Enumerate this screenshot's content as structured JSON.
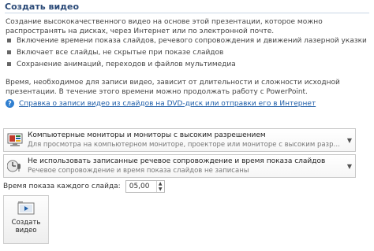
{
  "section": {
    "title": "Создать видео",
    "intro": "Создание высококачественного видео на основе этой презентации, которое можно распространять на дисках, через Интернет или по электронной почте.",
    "bullets": [
      "Включение времени показа слайдов, речевого сопровождения и движений лазерной указки",
      "Включает все слайды, не скрытые при показе слайдов",
      "Сохранение анимаций, переходов и файлов мультимедиа"
    ],
    "duration_note": "Время, необходимое для записи видео, зависит от длительности и сложности исходной презентации. В течение этого времени можно продолжать работу с PowerPoint.",
    "help_link": "Справка о записи видео из слайдов на DVD-диск или отправки его в Интернет"
  },
  "quality_dropdown": {
    "label": "Компьютерные мониторы и мониторы с высоким разрешением",
    "description": "Для просмотра на компьютерном мониторе, проекторе или мониторе с высоким разрешением (к..."
  },
  "narration_dropdown": {
    "label": "Не использовать записанные речевое сопровождение и время показа слайдов",
    "description": "Речевое сопровождение и время показа слайдов не записаны"
  },
  "slide_time": {
    "label": "Время показа каждого слайда:",
    "value": "05,00"
  },
  "create_button": {
    "label": "Создать\nвидео"
  }
}
